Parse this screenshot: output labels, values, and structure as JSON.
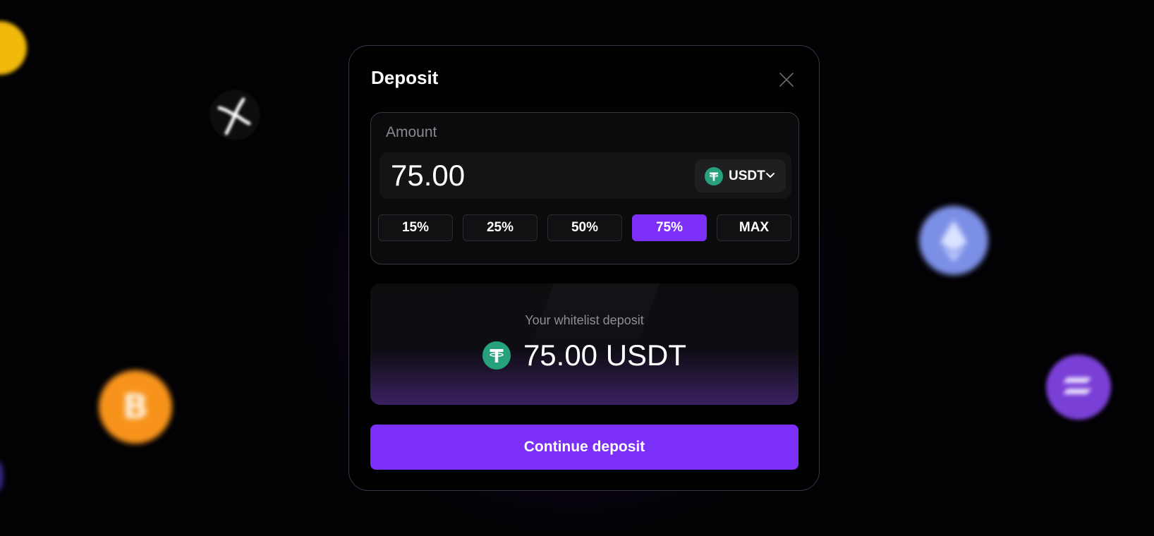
{
  "modal": {
    "title": "Deposit",
    "close_icon": "close-icon"
  },
  "amount": {
    "label": "Amount",
    "value": "75.00",
    "token": {
      "symbol": "USDT",
      "icon": "tether-icon",
      "color": "#26a17b"
    }
  },
  "percent_buttons": [
    {
      "label": "15%",
      "active": false
    },
    {
      "label": "25%",
      "active": false
    },
    {
      "label": "50%",
      "active": false
    },
    {
      "label": "75%",
      "active": true
    },
    {
      "label": "MAX",
      "active": false
    }
  ],
  "summary": {
    "label": "Your whitelist deposit",
    "value": "75.00 USDT",
    "icon": "tether-icon"
  },
  "continue_button": {
    "label": "Continue deposit"
  },
  "colors": {
    "accent": "#7b2ff7",
    "tether": "#26a17b",
    "background": "#020104"
  },
  "background_icons": [
    "bnb-coin-icon",
    "xrp-coin-icon",
    "bitcoin-coin-icon",
    "ethereum-coin-icon",
    "solana-coin-icon"
  ]
}
